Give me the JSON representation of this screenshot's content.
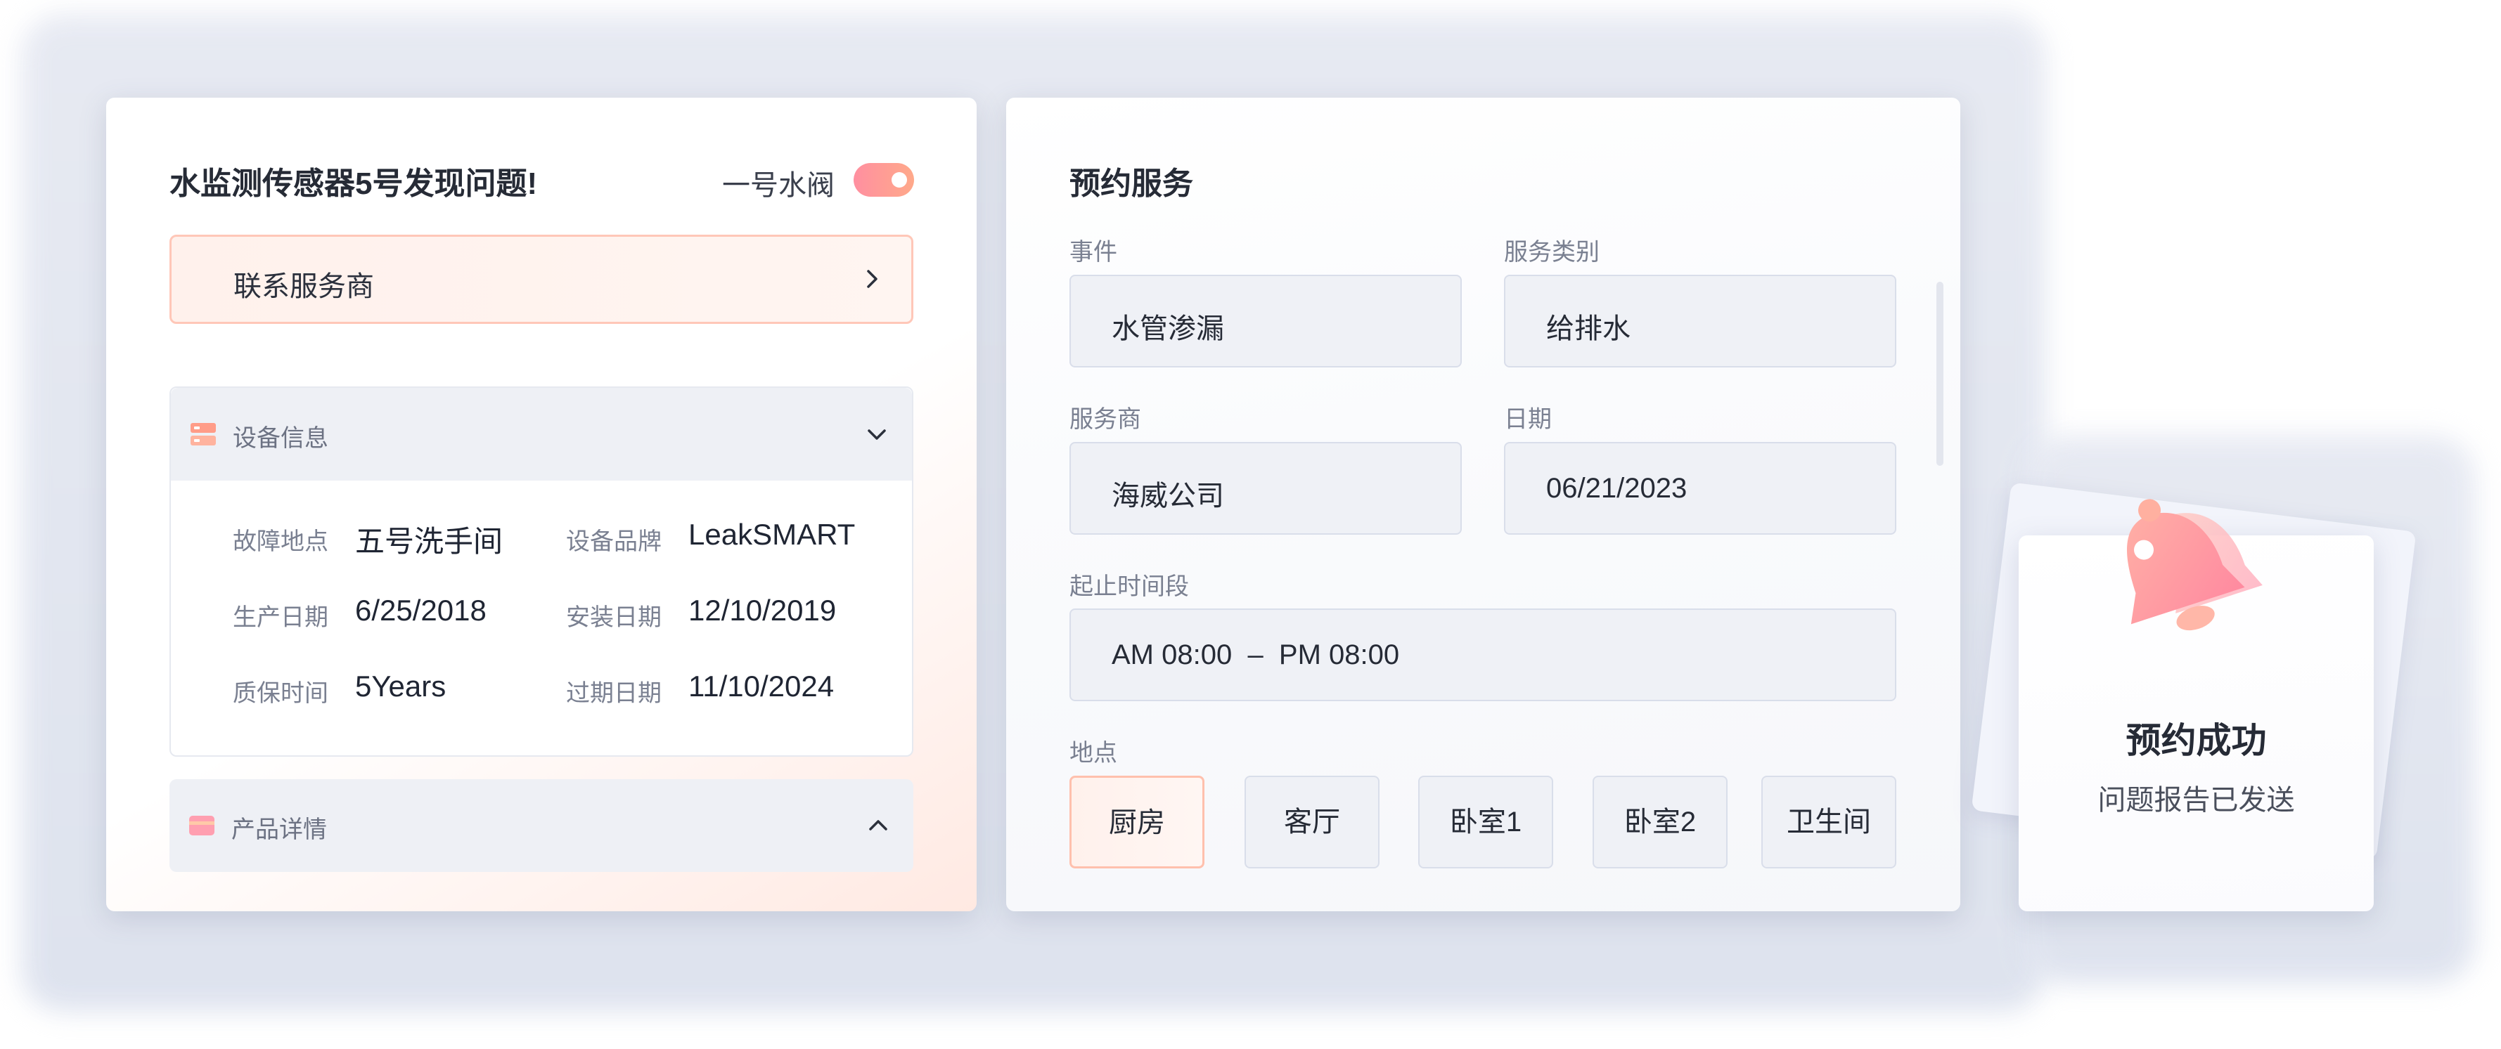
{
  "alert_card": {
    "title": "水监测传感器5号发现问题!",
    "valve_label": "一号水阀",
    "valve_on": true,
    "contact_label": "联系服务商",
    "device_info": {
      "header": "设备信息",
      "expanded": true,
      "rows": [
        {
          "k1": "故障地点",
          "v1": "五号洗手间",
          "k2": "设备品牌",
          "v2": "LeakSMART"
        },
        {
          "k1": "生产日期",
          "v1": "6/25/2018",
          "k2": "安装日期",
          "v2": "12/10/2019"
        },
        {
          "k1": "质保时间",
          "v1": "5Years",
          "k2": "过期日期",
          "v2": "11/10/2024"
        }
      ]
    },
    "product_details": {
      "header": "产品详情",
      "expanded": false
    },
    "accent_colors": {
      "pink": "#ff8fa0",
      "orange": "#ffa98a"
    }
  },
  "booking_card": {
    "title": "预约服务",
    "fields": {
      "event": {
        "label": "事件",
        "value": "水管渗漏"
      },
      "category": {
        "label": "服务类别",
        "value": "给排水"
      },
      "provider": {
        "label": "服务商",
        "value": "海威公司"
      },
      "date": {
        "label": "日期",
        "value": "06/21/2023"
      },
      "time_range": {
        "label": "起止时间段",
        "value": "AM 08:00  –  PM 08:00"
      }
    },
    "location": {
      "label": "地点",
      "options": [
        "厨房",
        "客厅",
        "卧室1",
        "卧室2",
        "卫生间"
      ],
      "selected": "厨房"
    }
  },
  "success_card": {
    "title": "预约成功",
    "subtitle": "问题报告已发送",
    "icon": "bell-icon"
  }
}
